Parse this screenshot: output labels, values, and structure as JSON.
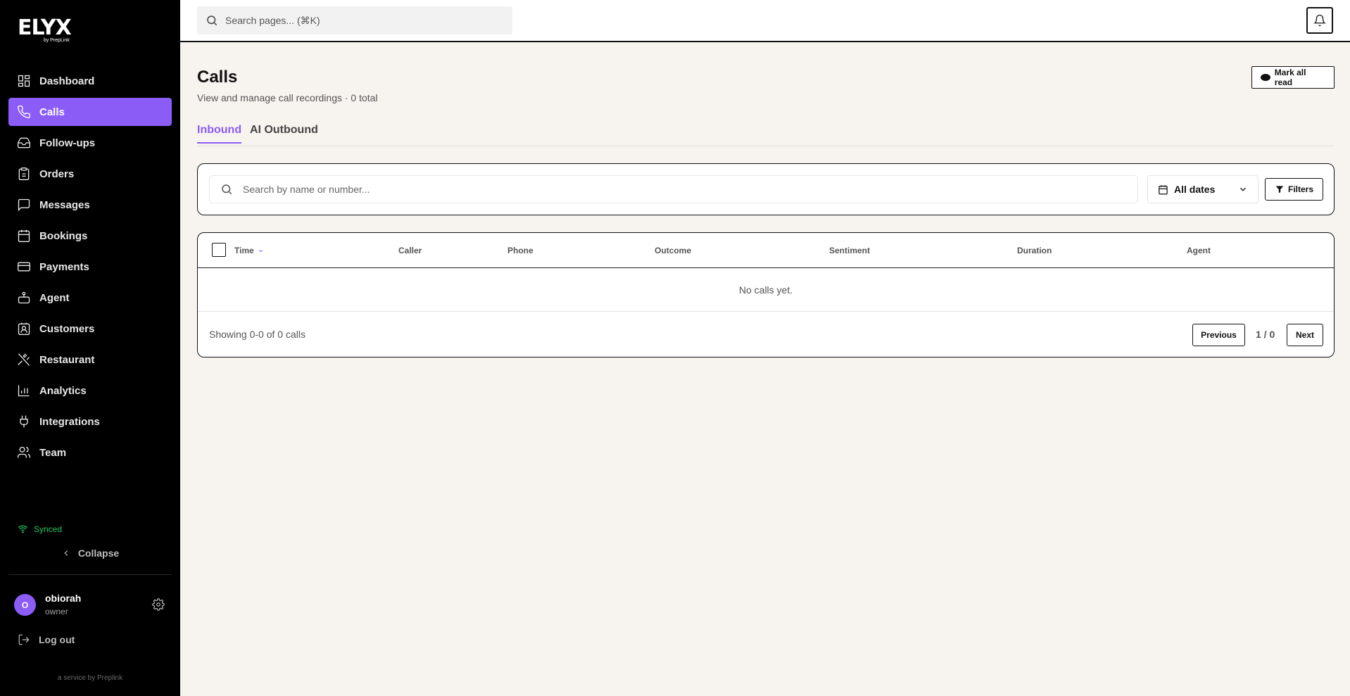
{
  "brand": {
    "name": "ELYX",
    "sub": "by PrepLink"
  },
  "sidebar": {
    "items": [
      {
        "label": "Dashboard",
        "icon": "dashboard-icon"
      },
      {
        "label": "Calls",
        "icon": "phone-icon",
        "active": true
      },
      {
        "label": "Follow-ups",
        "icon": "inbox-icon"
      },
      {
        "label": "Orders",
        "icon": "clipboard-icon"
      },
      {
        "label": "Messages",
        "icon": "message-icon"
      },
      {
        "label": "Bookings",
        "icon": "calendar-icon"
      },
      {
        "label": "Payments",
        "icon": "credit-card-icon"
      },
      {
        "label": "Agent",
        "icon": "bot-icon"
      },
      {
        "label": "Customers",
        "icon": "contact-icon"
      },
      {
        "label": "Restaurant",
        "icon": "utensils-icon"
      },
      {
        "label": "Analytics",
        "icon": "bar-chart-icon"
      },
      {
        "label": "Integrations",
        "icon": "plug-icon"
      },
      {
        "label": "Team",
        "icon": "users-icon"
      }
    ],
    "synced": "Synced",
    "collapse": "Collapse",
    "user": {
      "initial": "O",
      "name": "obiorah",
      "role": "owner"
    },
    "logout": "Log out",
    "service": "a service by Preplink"
  },
  "topbar": {
    "search_placeholder": "Search pages... (⌘K)"
  },
  "page": {
    "title": "Calls",
    "subtitle": "View and manage call recordings · 0 total",
    "mark_all_read": "Mark all read"
  },
  "tabs": {
    "inbound": "Inbound",
    "outbound": "AI Outbound"
  },
  "filters": {
    "search_placeholder": "Search by name or number...",
    "date_value": "All dates",
    "filters_label": "Filters"
  },
  "table": {
    "columns": [
      "Time",
      "Caller",
      "Phone",
      "Outcome",
      "Sentiment",
      "Duration",
      "Agent"
    ],
    "empty_text": "No calls yet.",
    "showing": "Showing 0-0 of 0 calls",
    "previous": "Previous",
    "page_indicator": "1 / 0",
    "next": "Next"
  },
  "colors": {
    "accent": "#8b5cf6",
    "sidebar_bg": "#000000",
    "page_bg": "#f7f3ef",
    "synced": "#22c55e"
  }
}
